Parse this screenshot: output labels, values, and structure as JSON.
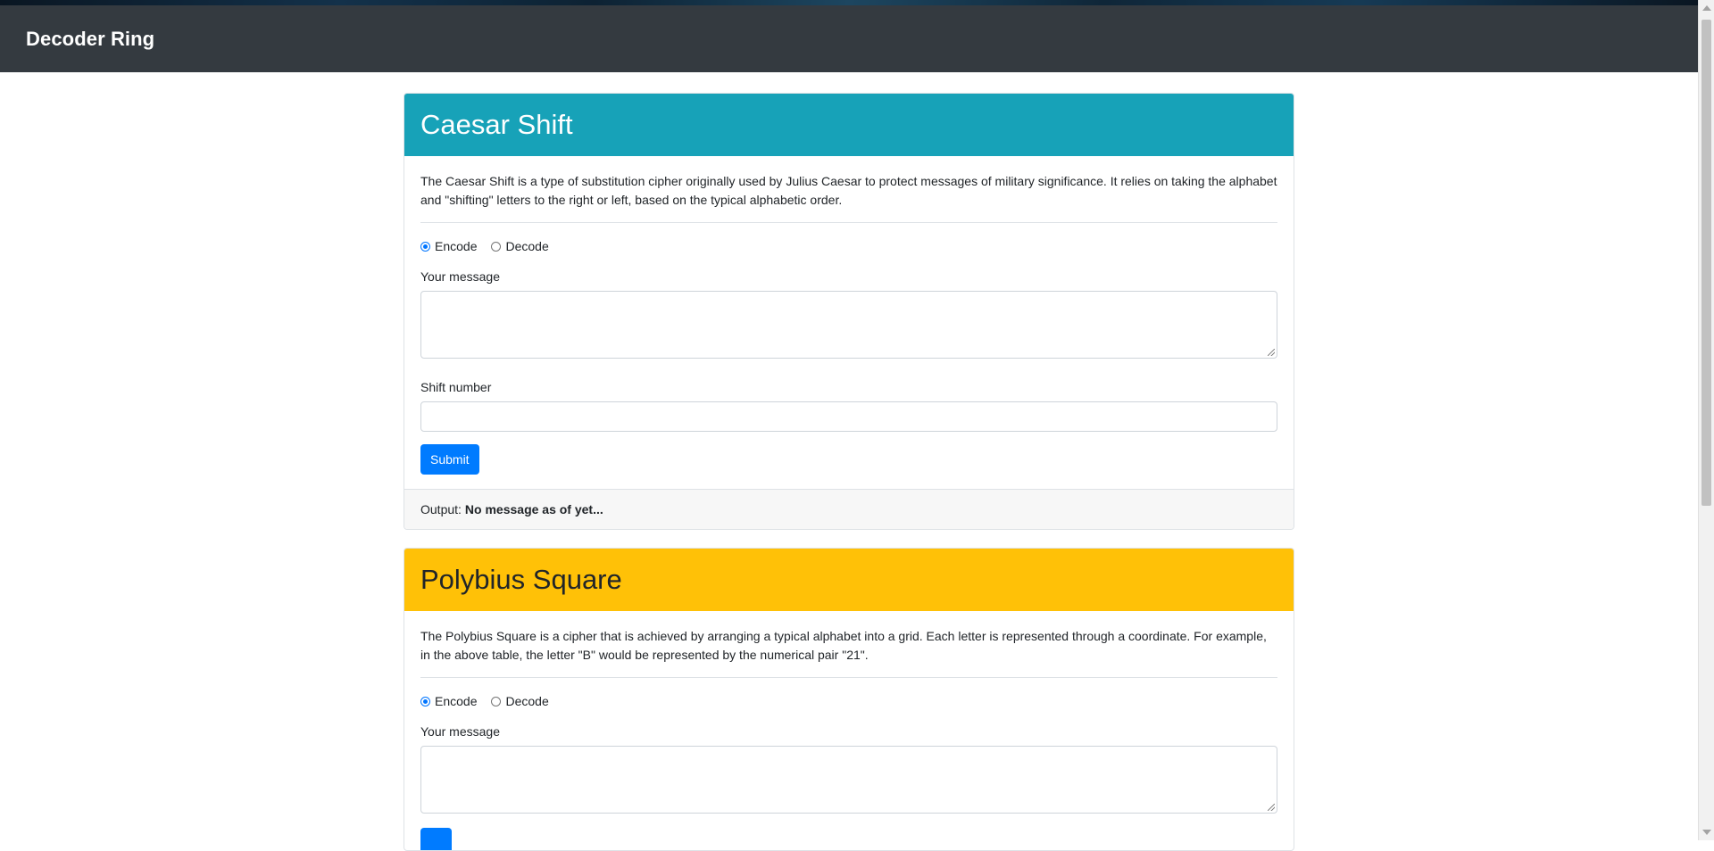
{
  "navbar": {
    "brand": "Decoder Ring"
  },
  "caesar": {
    "title": "Caesar Shift",
    "header_color": "#17a2b8",
    "description": "The Caesar Shift is a type of substitution cipher originally used by Julius Caesar to protect messages of military significance. It relies on taking the alphabet and \"shifting\" letters to the right or left, based on the typical alphabetic order.",
    "encode_label": "Encode",
    "decode_label": "Decode",
    "mode_selected": "Encode",
    "message_label": "Your message",
    "message_value": "",
    "shift_label": "Shift number",
    "shift_value": "",
    "submit_label": "Submit",
    "output_label": "Output:",
    "output_value": "No message as of yet..."
  },
  "polybius": {
    "title": "Polybius Square",
    "header_color": "#ffc107",
    "description": "The Polybius Square is a cipher that is achieved by arranging a typical alphabet into a grid. Each letter is represented through a coordinate. For example, in the above table, the letter \"B\" would be represented by the numerical pair \"21\".",
    "encode_label": "Encode",
    "decode_label": "Decode",
    "mode_selected": "Encode",
    "message_label": "Your message",
    "message_value": ""
  },
  "colors": {
    "navbar": "#343a40",
    "primary": "#007bff"
  }
}
